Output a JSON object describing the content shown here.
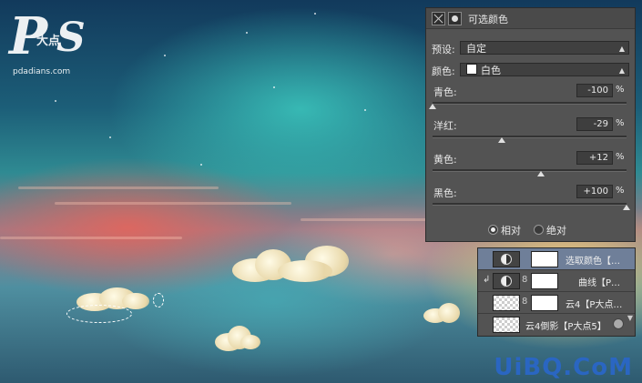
{
  "logo": {
    "letter_p": "P",
    "letter_s": "S",
    "chinese": "大点",
    "url": "pdadians.com"
  },
  "watermark": "UiBQ.CoM",
  "properties_panel": {
    "title": "可选颜色",
    "preset_label": "预设:",
    "preset_value": "自定",
    "colors_label": "颜色:",
    "colors_value": "白色",
    "sliders": [
      {
        "label": "青色:",
        "value": "-100",
        "unit": "%",
        "level": -100
      },
      {
        "label": "洋红:",
        "value": "-29",
        "unit": "%",
        "level": -29
      },
      {
        "label": "黄色:",
        "value": "+12",
        "unit": "%",
        "level": 12
      },
      {
        "label": "黑色:",
        "value": "+100",
        "unit": "%",
        "level": 100
      }
    ],
    "method_relative": "相对",
    "method_absolute": "绝对",
    "selected_method": "relative"
  },
  "layers_panel": {
    "layers": [
      {
        "name": "选取颜色【…",
        "active": true
      },
      {
        "name": "曲线【P…",
        "active": false
      },
      {
        "name": "云4【P大点…",
        "active": false
      },
      {
        "name": "云4倒影【P大点5】",
        "active": false
      }
    ]
  },
  "colors": {
    "panel_bg": "#535353",
    "active_layer": "#6f7f99",
    "watermark": "#2a66c2"
  }
}
